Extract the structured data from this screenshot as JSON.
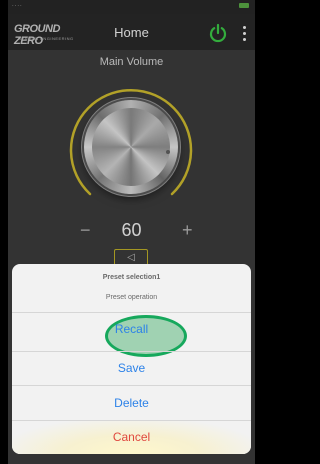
{
  "status_bar": {
    "carrier": "....",
    "battery_text": ""
  },
  "header": {
    "logo_main": "GROUND ZERO",
    "logo_sub": "GERMAN ENGINEERING",
    "title": "Home",
    "power_icon": "power-icon",
    "menu_icon": "more-vertical-icon"
  },
  "volume": {
    "label": "Main Volume",
    "value": "60",
    "minus": "−",
    "plus": "+",
    "mute_icon": "speaker-icon"
  },
  "action_sheet": {
    "title": "Preset selection1",
    "subtitle": "Preset operation",
    "options": {
      "recall": "Recall",
      "save": "Save",
      "delete": "Delete",
      "cancel": "Cancel"
    }
  },
  "colors": {
    "accent_blue": "#2d82e8",
    "cancel_red": "#e0483e",
    "power_green": "#3fd24b",
    "dial_ring_yellow": "#d9c531",
    "highlight_green": "#16a85c"
  }
}
